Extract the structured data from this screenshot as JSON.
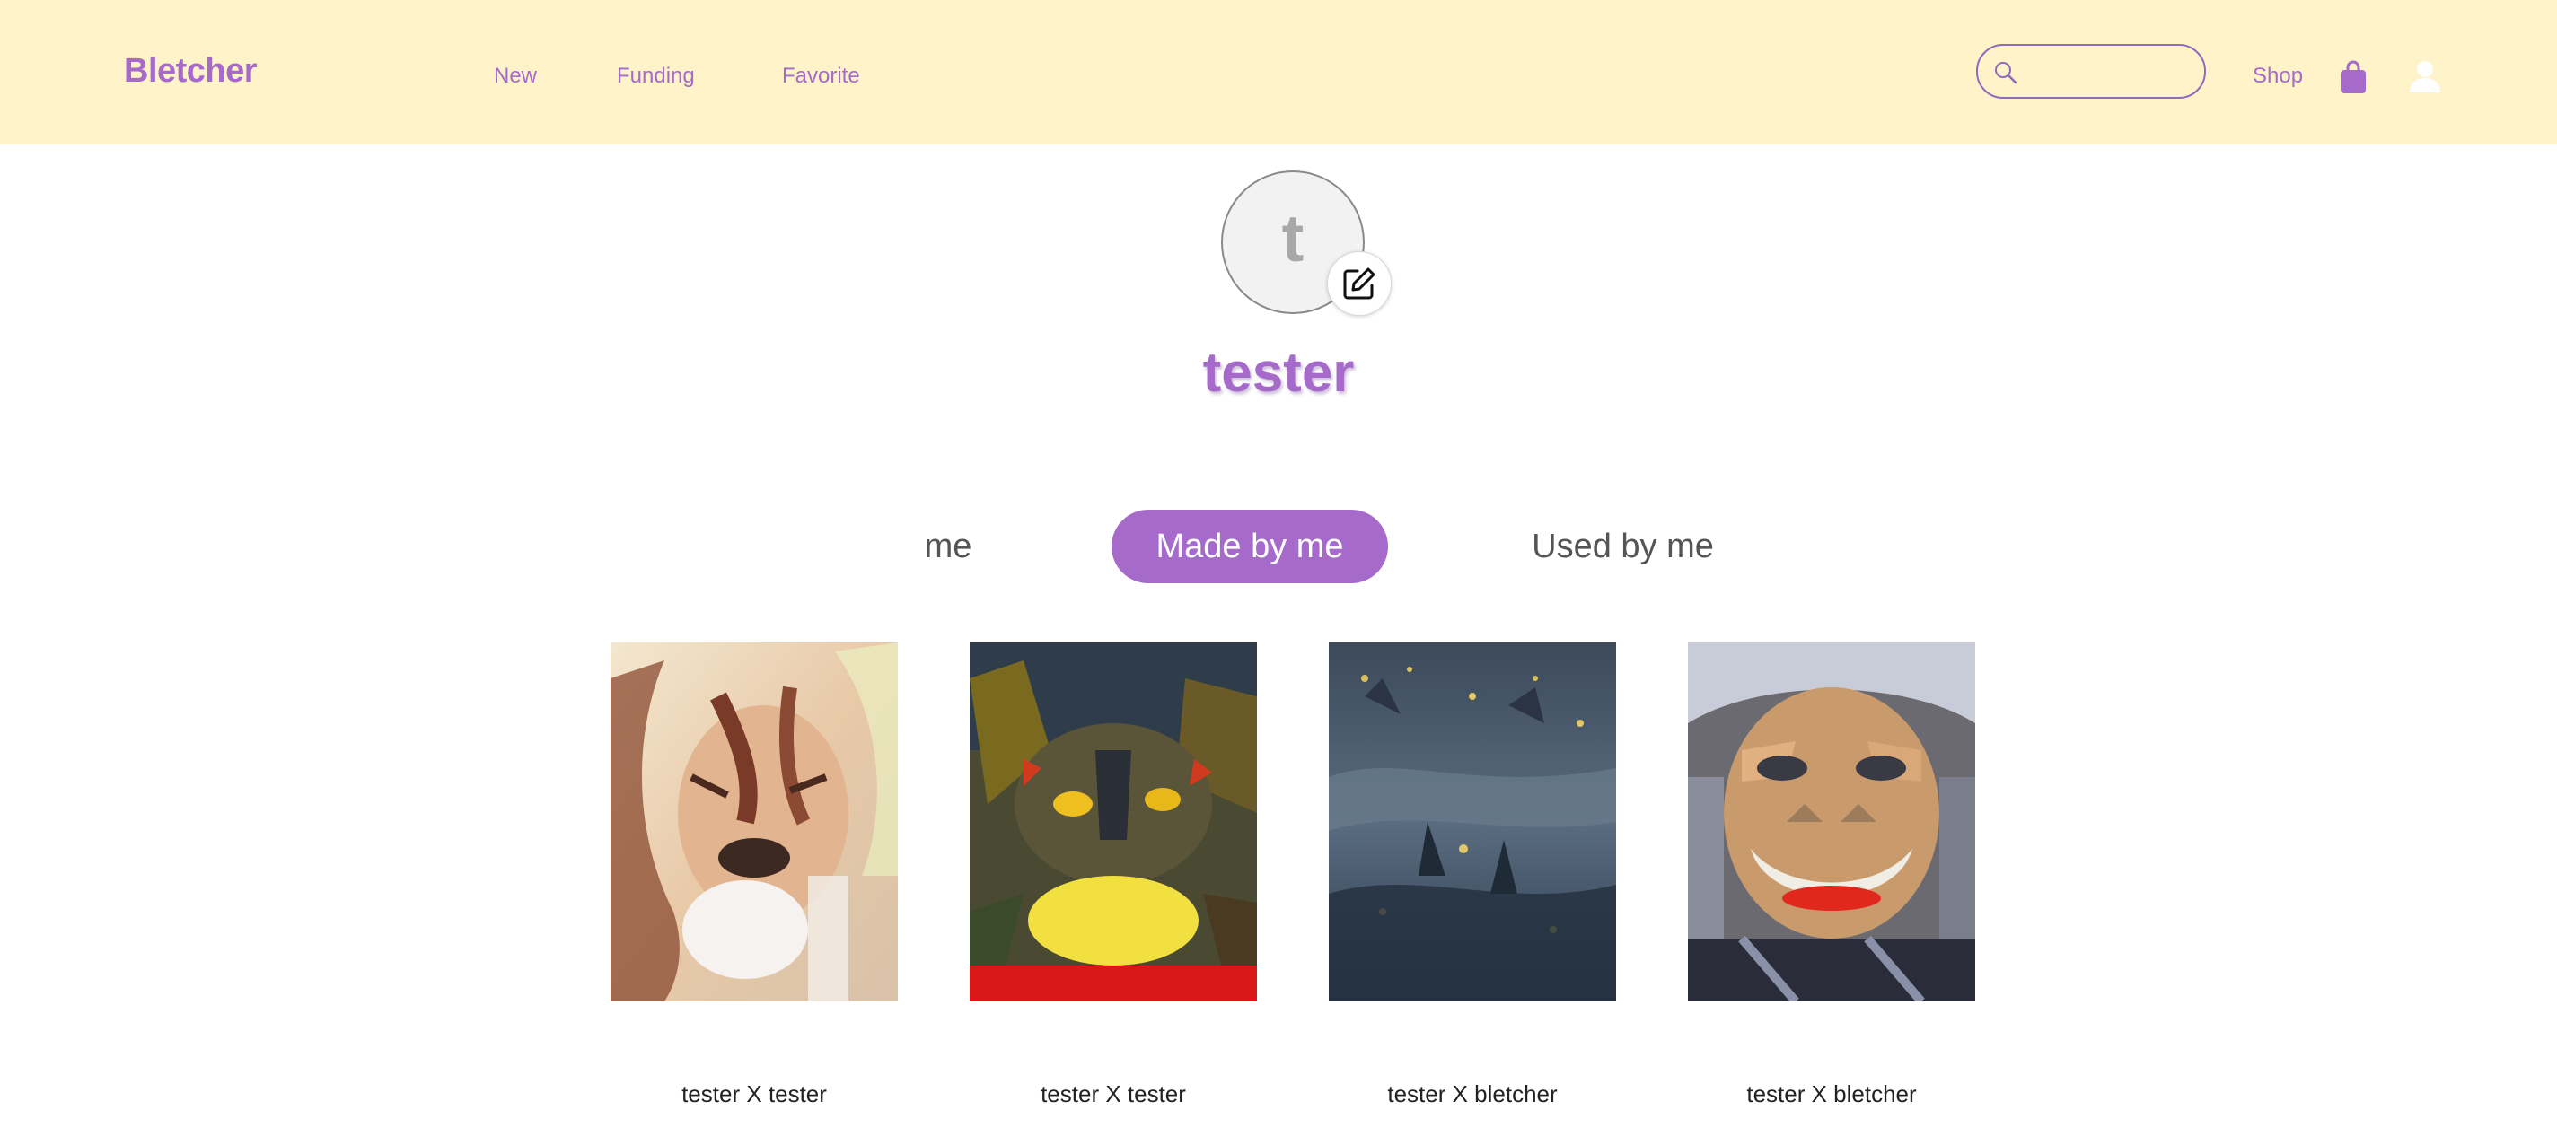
{
  "header": {
    "logo": "Bletcher",
    "nav": [
      {
        "label": "New"
      },
      {
        "label": "Funding"
      },
      {
        "label": "Favorite"
      }
    ],
    "search": {
      "placeholder": "",
      "value": "",
      "icon": "search-icon"
    },
    "shop_label": "Shop",
    "icons": [
      "shopping-bag-icon",
      "user-icon"
    ],
    "accent_color": "#a66bca",
    "background_color": "#fff3c9"
  },
  "profile": {
    "avatar_initial": "t",
    "username": "tester",
    "edit_icon": "edit-icon"
  },
  "tabs": [
    {
      "label": "me",
      "active": false
    },
    {
      "label": "Made by me",
      "active": true
    },
    {
      "label": "Used by me",
      "active": false
    }
  ],
  "gallery": [
    {
      "caption": "tester X tester",
      "image": "lion portrait painting"
    },
    {
      "caption": "tester X tester",
      "image": "abstract cat painting"
    },
    {
      "caption": "tester X bletcher",
      "image": "dark blue night painting"
    },
    {
      "caption": "tester X bletcher",
      "image": "smiling elderly woman portrait painting"
    }
  ]
}
